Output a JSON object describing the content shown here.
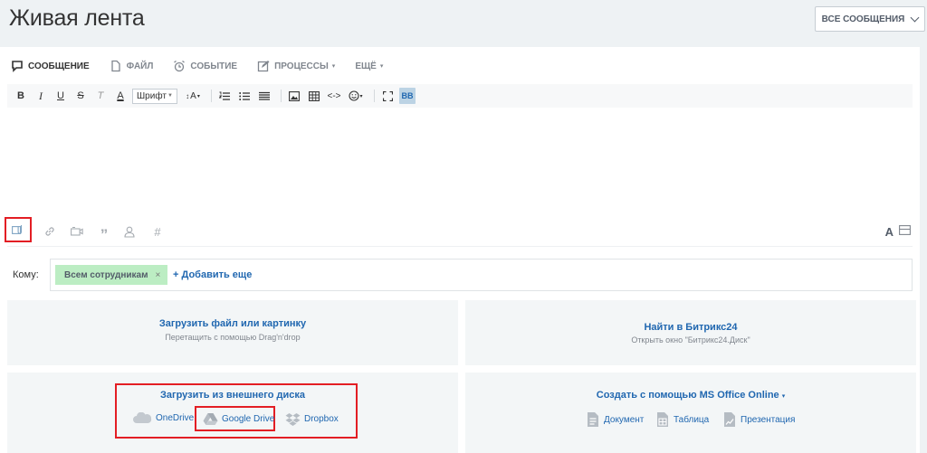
{
  "page": {
    "title": "Живая лента"
  },
  "filter_button": {
    "label": "ВСЕ СООБЩЕНИЯ"
  },
  "tabs": [
    {
      "label": "СООБЩЕНИЕ",
      "icon": "chat-icon"
    },
    {
      "label": "ФАЙЛ",
      "icon": "file-icon"
    },
    {
      "label": "СОБЫТИЕ",
      "icon": "alarm-clock-icon"
    },
    {
      "label": "ПРОЦЕССЫ",
      "icon": "edit-icon"
    },
    {
      "label": "ЕЩЁ",
      "icon": ""
    }
  ],
  "toolbar": {
    "bold": "B",
    "italic": "I",
    "underline": "U",
    "strike": "S",
    "clear": "T",
    "color": "A",
    "font_select": "Шрифт",
    "font_size": "A",
    "bbcode": "BB"
  },
  "recipients": {
    "label": "Кому:",
    "tags": [
      "Всем сотрудникам"
    ],
    "tag_remove": "×",
    "add_more": "+ Добавить еще"
  },
  "zones": {
    "upload": {
      "title": "Загрузить файл или картинку",
      "subtitle": "Перетащить с помощью Drag'n'drop"
    },
    "find": {
      "title": "Найти в Битрикс24",
      "subtitle": "Открыть окно \"Битрикс24.Диск\""
    },
    "external": {
      "title": "Загрузить из внешнего диска",
      "items": [
        "OneDrive",
        "Google Drive",
        "Dropbox"
      ]
    },
    "office": {
      "title": "Создать с помощью MS Office Online",
      "items": [
        "Документ",
        "Таблица",
        "Презентация"
      ]
    }
  },
  "colors": {
    "accent": "#2067b0",
    "highlight": "#e31e24",
    "tag_bg": "#bcedc3"
  }
}
